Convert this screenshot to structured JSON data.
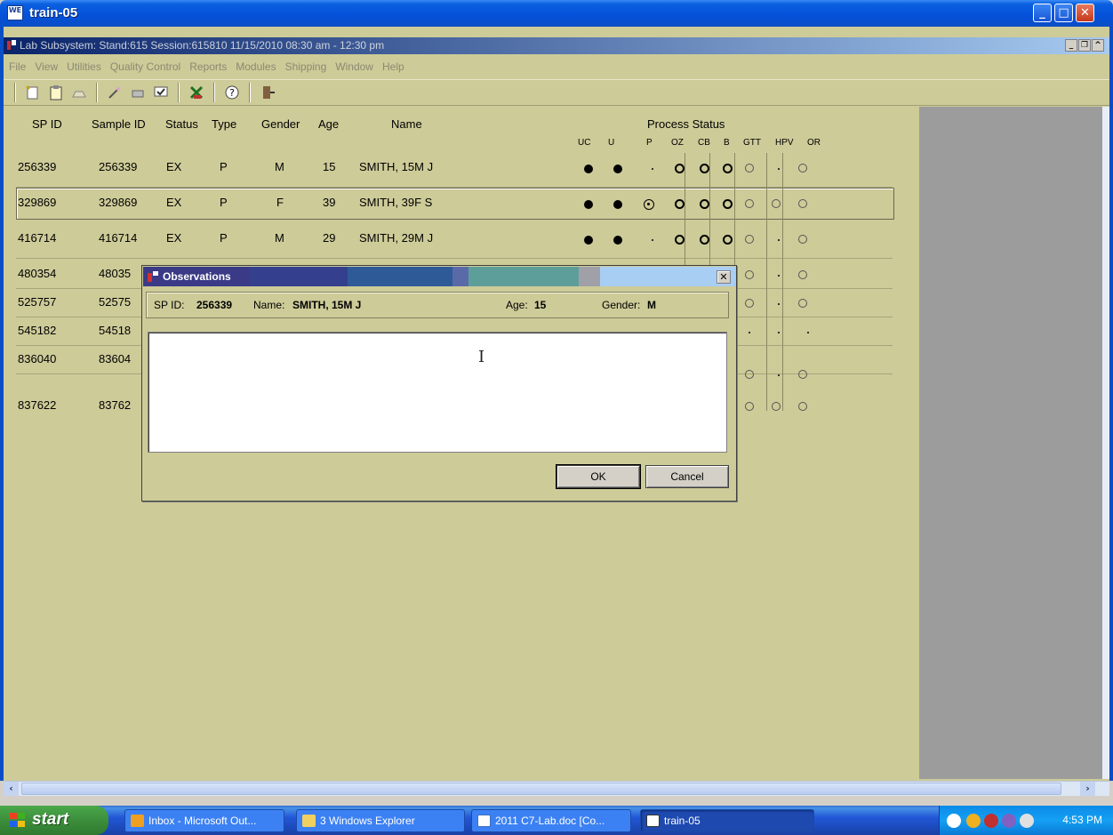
{
  "window": {
    "title": "train-05",
    "app_icon_text": "WE"
  },
  "subwindow": {
    "title": "Lab Subsystem: Stand:615 Session:615810 11/15/2010 08:30 am - 12:30 pm"
  },
  "menu": [
    "File",
    "View",
    "Utilities",
    "Quality Control",
    "Reports",
    "Modules",
    "Shipping",
    "Window",
    "Help"
  ],
  "toolbar": [
    {
      "icon": "new-icon"
    },
    {
      "icon": "clipboard-icon"
    },
    {
      "icon": "open-icon"
    },
    {
      "icon": "magic-wand-icon"
    },
    {
      "icon": "printer-icon"
    },
    {
      "icon": "check-icon"
    },
    {
      "icon": "chart-icon"
    },
    {
      "icon": "help-icon"
    },
    {
      "icon": "exit-icon"
    }
  ],
  "table": {
    "headers": [
      "SP ID",
      "Sample ID",
      "Status",
      "Type",
      "Gender",
      "Age",
      "Name"
    ],
    "process_status_title": "Process Status",
    "process_columns": [
      "UC",
      "U",
      "P",
      "OZ",
      "CB",
      "B",
      "GTT",
      "HPV",
      "OR"
    ],
    "rows": [
      {
        "sp_id": "256339",
        "sample_id": "256339",
        "status": "EX",
        "type": "P",
        "gender": "M",
        "age": "15",
        "name": "SMITH, 15M J"
      },
      {
        "sp_id": "329869",
        "sample_id": "329869",
        "status": "EX",
        "type": "P",
        "gender": "F",
        "age": "39",
        "name": "SMITH, 39F S"
      },
      {
        "sp_id": "416714",
        "sample_id": "416714",
        "status": "EX",
        "type": "P",
        "gender": "M",
        "age": "29",
        "name": "SMITH, 29M J"
      },
      {
        "sp_id": "480354",
        "sample_id": "48035",
        "status": "",
        "type": "",
        "gender": "",
        "age": "",
        "name": ""
      },
      {
        "sp_id": "525757",
        "sample_id": "52575",
        "status": "",
        "type": "",
        "gender": "",
        "age": "",
        "name": ""
      },
      {
        "sp_id": "545182",
        "sample_id": "54518",
        "status": "",
        "type": "",
        "gender": "",
        "age": "",
        "name": ""
      },
      {
        "sp_id": "836040",
        "sample_id": "83604",
        "status": "",
        "type": "",
        "gender": "",
        "age": "",
        "name": ""
      },
      {
        "sp_id": "837622",
        "sample_id": "83762",
        "status": "",
        "type": "",
        "gender": "",
        "age": "",
        "name": ""
      }
    ]
  },
  "dialog": {
    "title": "Observations",
    "sp_id_label": "SP ID:",
    "sp_id": "256339",
    "name_label": "Name:",
    "name": "SMITH, 15M J",
    "age_label": "Age:",
    "age": "15",
    "gender_label": "Gender:",
    "gender": "M",
    "observation_text": "",
    "ok_label": "OK",
    "cancel_label": "Cancel"
  },
  "taskbar": {
    "start_label": "start",
    "tasks": [
      "Inbox - Microsoft Out...",
      "3 Windows Explorer",
      "2011 C7-Lab.doc [Co...",
      "train-05"
    ],
    "time": "4:53 PM"
  },
  "colors": {
    "xp_blue": "#0a5fe0",
    "app_bg": "#cdcb98",
    "start_green": "#3c8e3c"
  }
}
